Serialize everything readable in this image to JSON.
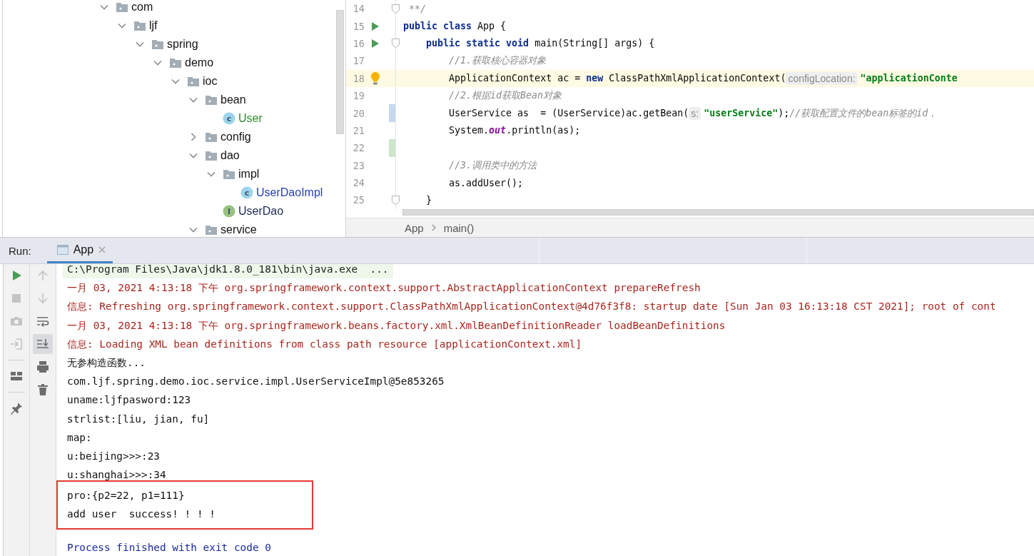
{
  "project_tree": [
    {
      "label": "com",
      "kind": "folder",
      "expanded": true,
      "children": [
        {
          "label": "ljf",
          "kind": "folder",
          "expanded": true,
          "children": [
            {
              "label": "spring",
              "kind": "folder",
              "expanded": true,
              "children": [
                {
                  "label": "demo",
                  "kind": "folder",
                  "expanded": true,
                  "children": [
                    {
                      "label": "ioc",
                      "kind": "folder",
                      "expanded": true,
                      "children": [
                        {
                          "label": "bean",
                          "kind": "folder",
                          "expanded": true,
                          "children": [
                            {
                              "label": "User",
                              "kind": "class",
                              "badge": "c",
                              "color": "#2f8a2f"
                            }
                          ]
                        },
                        {
                          "label": "config",
                          "kind": "folder",
                          "expanded": false
                        },
                        {
                          "label": "dao",
                          "kind": "folder",
                          "expanded": true,
                          "children": [
                            {
                              "label": "impl",
                              "kind": "folder",
                              "expanded": true,
                              "children": [
                                {
                                  "label": "UserDaoImpl",
                                  "kind": "class",
                                  "badge": "c",
                                  "color": "#2540b8"
                                }
                              ]
                            },
                            {
                              "label": "UserDao",
                              "kind": "interface",
                              "badge": "I",
                              "color": "#1c2a55"
                            }
                          ]
                        },
                        {
                          "label": "service",
                          "kind": "folder",
                          "expanded": true
                        }
                      ]
                    }
                  ]
                }
              ]
            }
          ]
        }
      ]
    }
  ],
  "editor": {
    "lines": [
      {
        "number": "14",
        "run": false,
        "fold": true,
        "bulb": false,
        "current": false,
        "parts": [
          {
            "kind": "code",
            "tokens": [
              {
                "kind": "comment",
                "text": " **/"
              }
            ]
          }
        ]
      },
      {
        "number": "15",
        "run": true,
        "fold": false,
        "bulb": false,
        "current": false,
        "parts": [
          {
            "kind": "code",
            "tokens": [
              {
                "kind": "keyword",
                "text": "public class"
              },
              {
                "kind": "plain",
                "text": " App {"
              }
            ]
          }
        ]
      },
      {
        "number": "16",
        "run": true,
        "fold": true,
        "bulb": false,
        "current": false,
        "parts": [
          {
            "kind": "code",
            "tokens": [
              {
                "kind": "keyword",
                "text": "    public static void"
              },
              {
                "kind": "plain",
                "text": " main(String[] args) {"
              }
            ]
          }
        ]
      },
      {
        "number": "17",
        "run": false,
        "fold": false,
        "bulb": false,
        "current": false,
        "parts": [
          {
            "kind": "code",
            "tokens": [
              {
                "kind": "comment",
                "text": "        //1.获取核心容器对象"
              }
            ]
          }
        ]
      },
      {
        "number": "18",
        "run": false,
        "fold": false,
        "bulb": true,
        "current": true,
        "parts": [
          {
            "kind": "code",
            "tokens": [
              {
                "kind": "plain",
                "text": "        ApplicationContext ac = "
              },
              {
                "kind": "keyword",
                "text": "new"
              },
              {
                "kind": "plain",
                "text": " ClassPathXmlApplicationContext("
              }
            ]
          },
          {
            "kind": "hint",
            "text": "configLocation:"
          },
          {
            "kind": "code",
            "tokens": [
              {
                "kind": "string",
                "text": "\"applicationConte"
              }
            ]
          }
        ]
      },
      {
        "number": "19",
        "run": false,
        "fold": false,
        "bulb": false,
        "current": false,
        "parts": [
          {
            "kind": "code",
            "tokens": [
              {
                "kind": "comment",
                "text": "        //2.根据id获取Bean对象"
              }
            ]
          }
        ]
      },
      {
        "number": "20",
        "run": false,
        "fold": false,
        "bulb": false,
        "current": false,
        "modified": true,
        "added": false,
        "parts": [
          {
            "kind": "code",
            "tokens": [
              {
                "kind": "plain",
                "text": "        UserService as  = (UserService)ac.getBean("
              }
            ]
          },
          {
            "kind": "hint",
            "text": "s:"
          },
          {
            "kind": "code",
            "tokens": [
              {
                "kind": "string",
                "text": "\"userService\""
              },
              {
                "kind": "plain",
                "text": ");"
              },
              {
                "kind": "comment",
                "text": "//获取配置文件的bean标签的id，"
              }
            ]
          }
        ]
      },
      {
        "number": "21",
        "run": false,
        "fold": false,
        "bulb": false,
        "current": false,
        "parts": [
          {
            "kind": "code",
            "tokens": [
              {
                "kind": "plain",
                "text": "        System."
              },
              {
                "kind": "field",
                "text": "out"
              },
              {
                "kind": "plain",
                "text": ".println(as);"
              }
            ]
          }
        ]
      },
      {
        "number": "22",
        "run": false,
        "fold": false,
        "bulb": false,
        "current": false,
        "modified": false,
        "added": true
      },
      {
        "number": "23",
        "run": false,
        "fold": false,
        "bulb": false,
        "current": false,
        "parts": [
          {
            "kind": "code",
            "tokens": [
              {
                "kind": "comment",
                "text": "        //3.调用类中的方法"
              }
            ]
          }
        ]
      },
      {
        "number": "24",
        "run": false,
        "fold": false,
        "bulb": false,
        "current": false,
        "parts": [
          {
            "kind": "code",
            "tokens": [
              {
                "kind": "plain",
                "text": "        as.addUser();"
              }
            ]
          }
        ]
      },
      {
        "number": "25",
        "run": false,
        "fold": true,
        "bulb": false,
        "current": false,
        "parts": [
          {
            "kind": "code",
            "tokens": [
              {
                "kind": "plain",
                "text": "    }"
              }
            ]
          }
        ]
      }
    ],
    "breadcrumbs": [
      "App",
      "main()"
    ]
  },
  "run_panel": {
    "label": "Run:",
    "tabs": [
      {
        "label": "App",
        "selected": true
      }
    ],
    "left_toolbar": [
      [
        {
          "kind": "run",
          "disabled": false,
          "selected": false
        },
        {
          "kind": "stop",
          "disabled": true,
          "selected": false
        },
        {
          "kind": "camera",
          "disabled": true,
          "selected": false
        },
        {
          "kind": "enter",
          "disabled": true,
          "selected": false
        }
      ],
      [
        {
          "kind": "layout",
          "disabled": false,
          "selected": false
        }
      ],
      [
        {
          "kind": "pin",
          "disabled": false,
          "selected": false
        }
      ]
    ],
    "right_toolbar": [
      [
        {
          "kind": "up",
          "disabled": true,
          "selected": false
        },
        {
          "kind": "down",
          "disabled": true,
          "selected": false
        },
        {
          "kind": "wrap",
          "disabled": false,
          "selected": false
        },
        {
          "kind": "scroll-end",
          "disabled": false,
          "selected": true
        },
        {
          "kind": "print",
          "disabled": false,
          "selected": false
        },
        {
          "kind": "trash",
          "disabled": false,
          "selected": false
        }
      ]
    ],
    "console": [
      {
        "kind": "command",
        "boxed": false,
        "text": "C:\\Program Files\\Java\\jdk1.8.0_181\\bin\\java.exe  ..."
      },
      {
        "kind": "stderr",
        "boxed": false,
        "text": "一月 03, 2021 4:13:18 下午 org.springframework.context.support.AbstractApplicationContext prepareRefresh"
      },
      {
        "kind": "stderr",
        "boxed": false,
        "text": "信息: Refreshing org.springframework.context.support.ClassPathXmlApplicationContext@4d76f3f8: startup date [Sun Jan 03 16:13:18 CST 2021]; root of cont"
      },
      {
        "kind": "stderr",
        "boxed": false,
        "text": "一月 03, 2021 4:13:18 下午 org.springframework.beans.factory.xml.XmlBeanDefinitionReader loadBeanDefinitions"
      },
      {
        "kind": "stderr",
        "boxed": false,
        "text": "信息: Loading XML bean definitions from class path resource [applicationContext.xml]"
      },
      {
        "kind": "stdout",
        "boxed": false,
        "text": "无参构造函数..."
      },
      {
        "kind": "stdout",
        "boxed": false,
        "text": "com.ljf.spring.demo.ioc.service.impl.UserServiceImpl@5e853265"
      },
      {
        "kind": "stdout",
        "boxed": false,
        "text": "uname:ljfpasword:123"
      },
      {
        "kind": "stdout",
        "boxed": false,
        "text": "strlist:[liu, jian, fu]"
      },
      {
        "kind": "stdout",
        "boxed": false,
        "text": "map:"
      },
      {
        "kind": "stdout",
        "boxed": false,
        "text": "u:beijing>>>:23"
      },
      {
        "kind": "stdout",
        "boxed": false,
        "text": "u:shanghai>>>:34"
      },
      {
        "kind": "stdout",
        "boxed": true,
        "text": "pro:{p2=22, p1=111}"
      },
      {
        "kind": "stdout",
        "boxed": true,
        "text": "add user  success! ! ! !"
      },
      {
        "kind": "system",
        "boxed": false,
        "text": "Process finished with exit code 0"
      }
    ]
  }
}
